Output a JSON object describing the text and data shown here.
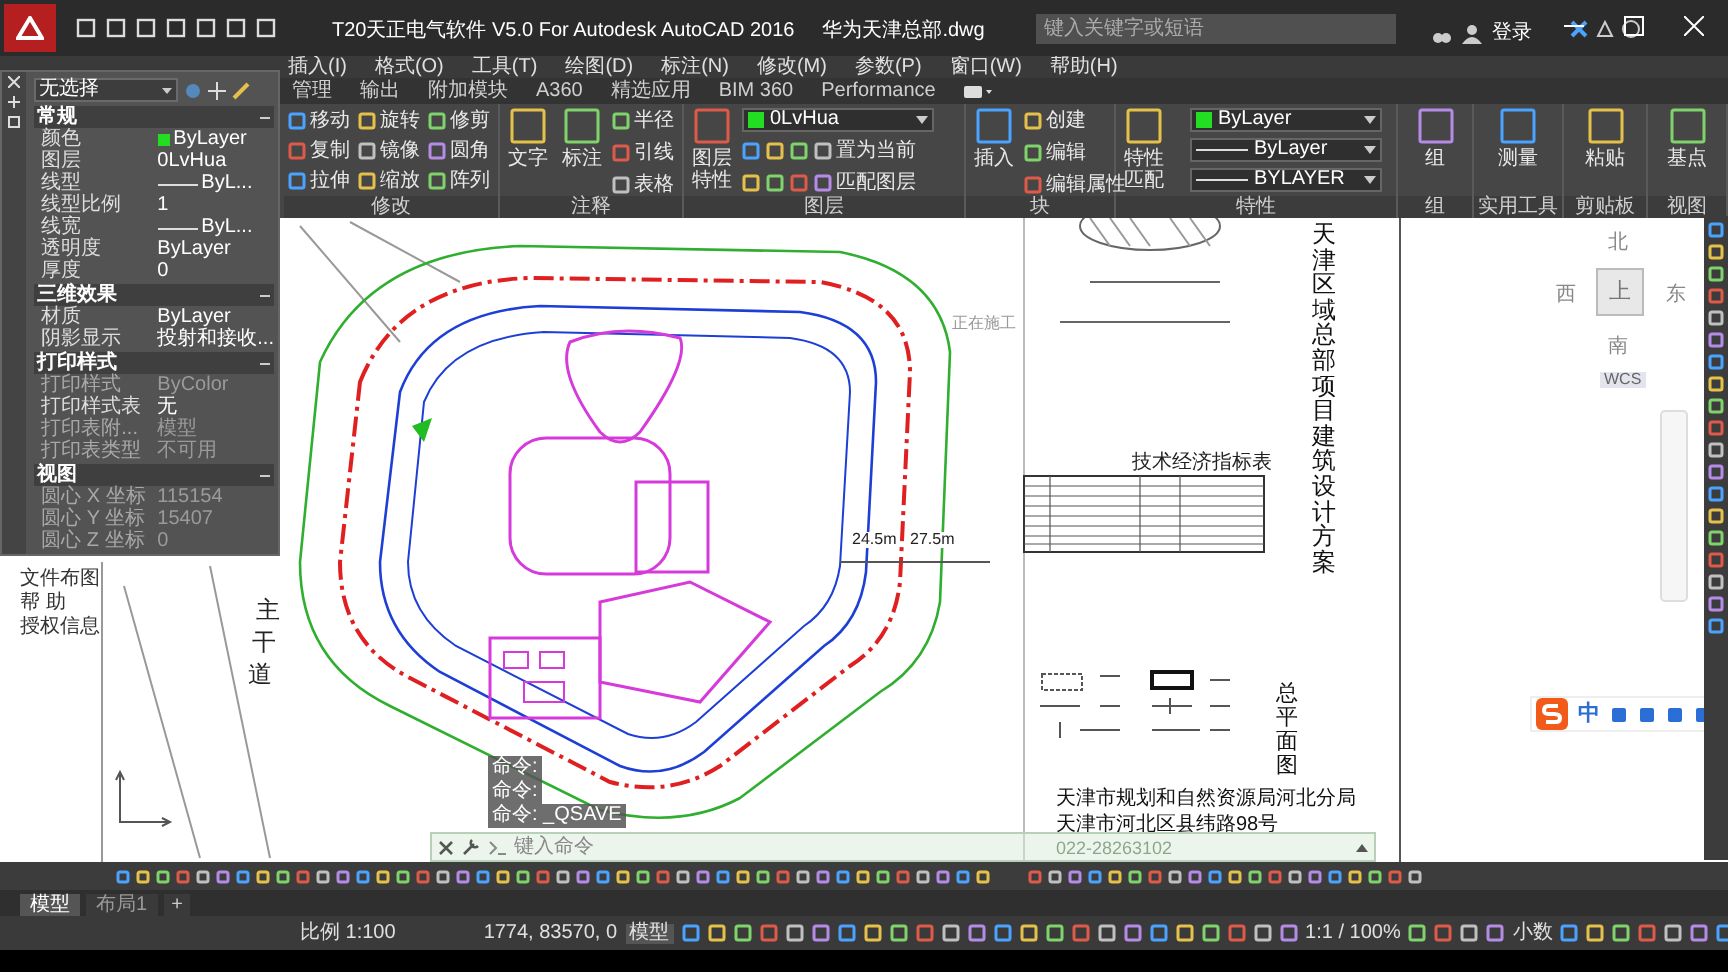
{
  "title_bar": {
    "app_title": "T20天正电气软件 V5.0 For Autodesk AutoCAD 2016",
    "file_name": "华为天津总部.dwg",
    "search": {
      "placeholder": "键入关键字或短语"
    },
    "sign_in": "登录"
  },
  "menu_bar": [
    "插入(I)",
    "格式(O)",
    "工具(T)",
    "绘图(D)",
    "标注(N)",
    "修改(M)",
    "参数(P)",
    "窗口(W)",
    "帮助(H)"
  ],
  "ribbon_tabs": [
    "管理",
    "输出",
    "附加模块",
    "A360",
    "精选应用",
    "BIM 360",
    "Performance"
  ],
  "ribbon_panels": [
    {
      "kind": "modify",
      "title": "修改",
      "tools": [
        "移动",
        "旋转",
        "修剪",
        "复制",
        "镜像",
        "圆角",
        "拉伸",
        "缩放",
        "阵列"
      ]
    },
    {
      "kind": "annotate",
      "title": "注释",
      "large": [
        "文字",
        "标注"
      ],
      "tools": [
        "半径",
        "引线",
        "表格"
      ]
    },
    {
      "kind": "layers",
      "title": "图层",
      "large": [
        "图层特性"
      ],
      "layer": "0LvHua",
      "tools": [
        "置为当前",
        "匹配图层"
      ]
    },
    {
      "kind": "block",
      "title": "块",
      "large": [
        "插入"
      ],
      "tools": [
        "创建",
        "编辑",
        "编辑属性"
      ]
    },
    {
      "kind": "properties",
      "title": "特性",
      "large": [
        "特性匹配"
      ],
      "color_setting": "ByLayer",
      "linetype": "ByLayer",
      "lineweight": "BYLAYER"
    },
    {
      "kind": "single",
      "title": "组",
      "large": [
        "组"
      ]
    },
    {
      "kind": "single",
      "title": "实用工具",
      "large": [
        "测量"
      ]
    },
    {
      "kind": "single",
      "title": "剪贴板",
      "large": [
        "粘贴"
      ]
    },
    {
      "kind": "single",
      "title": "视图",
      "large": [
        "基点"
      ]
    }
  ],
  "properties_palette": {
    "selection": "无选择",
    "sections": [
      {
        "title": "常规",
        "rows": [
          {
            "label": "颜色",
            "value": "ByLayer",
            "kind": "color",
            "disabled": false
          },
          {
            "label": "图层",
            "value": "0LvHua",
            "kind": "text",
            "disabled": false
          },
          {
            "label": "线型",
            "value": "ByL...",
            "kind": "line",
            "disabled": false
          },
          {
            "label": "线型比例",
            "value": "1",
            "kind": "text",
            "disabled": false
          },
          {
            "label": "线宽",
            "value": "ByL...",
            "kind": "line",
            "disabled": false
          },
          {
            "label": "透明度",
            "value": "ByLayer",
            "kind": "text",
            "disabled": false
          },
          {
            "label": "厚度",
            "value": "0",
            "kind": "text",
            "disabled": false
          }
        ]
      },
      {
        "title": "三维效果",
        "rows": [
          {
            "label": "材质",
            "value": "ByLayer",
            "kind": "text",
            "disabled": false
          },
          {
            "label": "阴影显示",
            "value": "投射和接收...",
            "kind": "text",
            "disabled": false
          }
        ]
      },
      {
        "title": "打印样式",
        "rows": [
          {
            "label": "打印样式",
            "value": "ByColor",
            "kind": "text",
            "disabled": true
          },
          {
            "label": "打印样式表",
            "value": "无",
            "kind": "text",
            "disabled": false
          },
          {
            "label": "打印表附...",
            "value": "模型",
            "kind": "text",
            "disabled": true
          },
          {
            "label": "打印表类型",
            "value": "不可用",
            "kind": "text",
            "disabled": true
          }
        ]
      },
      {
        "title": "视图",
        "rows": [
          {
            "label": "圆心 X 坐标",
            "value": "115154",
            "kind": "text",
            "disabled": true
          },
          {
            "label": "圆心 Y 坐标",
            "value": "15407",
            "kind": "text",
            "disabled": true
          },
          {
            "label": "圆心 Z 坐标",
            "value": "0",
            "kind": "text",
            "disabled": true
          }
        ]
      }
    ]
  },
  "side_menu": [
    "文件布图",
    "帮 助",
    "授权信息"
  ],
  "drawing": {
    "street_labels": [
      "主",
      "干",
      "道"
    ],
    "construction_note": "正在施工",
    "road_widths": [
      "24.5m",
      "27.5m"
    ],
    "project_title": "天津区域总部项目建筑设计方案",
    "sheet_title": "总平面图",
    "table_title": "技术经济指标表",
    "address_lines": [
      "天津市规划和自然资源局河北分局",
      "天津市河北区县纬路98号"
    ],
    "phone": "022-28263102"
  },
  "view_cube": {
    "north": "北",
    "west": "西",
    "top": "上",
    "east": "东",
    "south": "南",
    "ucs": "WCS"
  },
  "command_history": [
    "命令:",
    "命令:",
    "命令: _QSAVE"
  ],
  "command_line": {
    "placeholder": "键入命令"
  },
  "layout_tabs": [
    {
      "label": "模型",
      "selected": true
    },
    {
      "label": "布局1",
      "selected": false
    }
  ],
  "add_tab": "+",
  "status_bar": {
    "scale": "比例 1:100",
    "coordinates": "1774, 83570, 0",
    "space": "模型",
    "annotation_scale": "1:1 / 100%",
    "units": "小数"
  },
  "ime_bar": {
    "mode": "中"
  }
}
